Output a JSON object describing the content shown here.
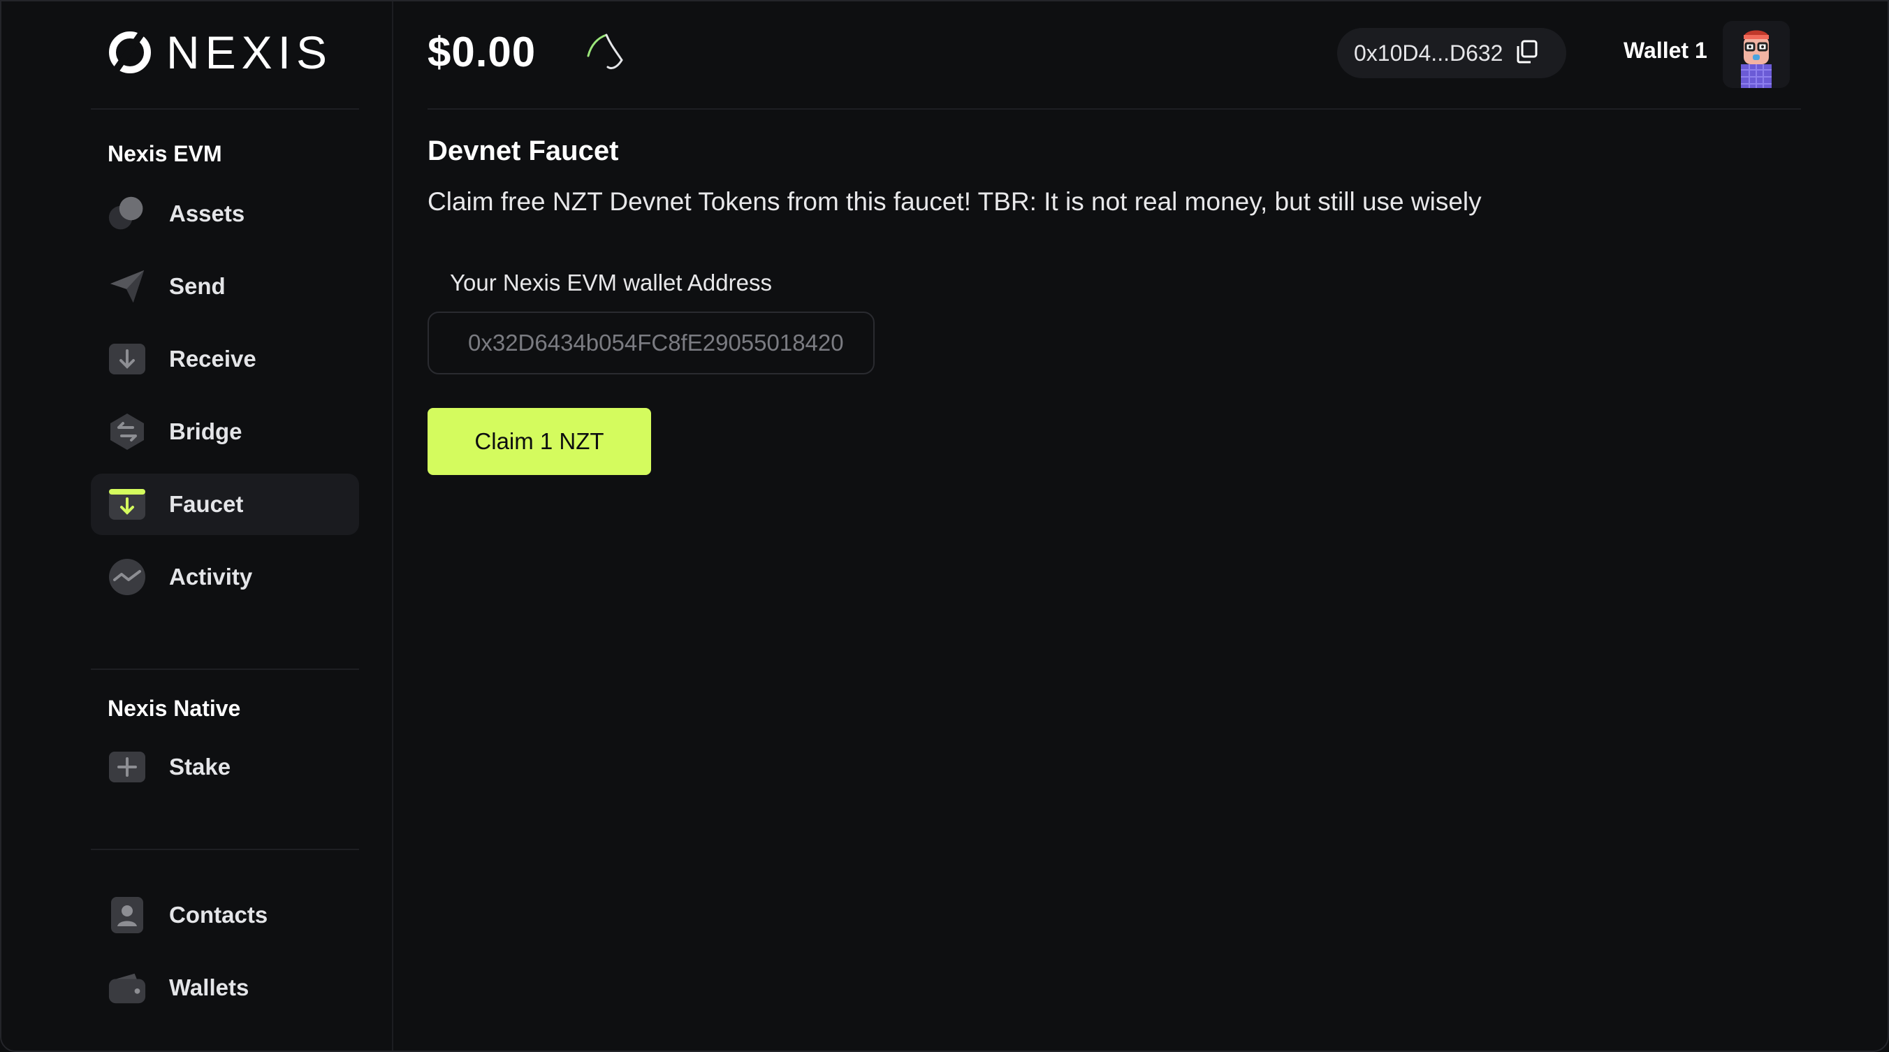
{
  "brand": {
    "logo_text": "NEXIS"
  },
  "header": {
    "balance": "$0.00",
    "address": "0x10D4...D632",
    "wallet_name": "Wallet 1"
  },
  "sidebar": {
    "sections": [
      {
        "title": "Nexis EVM",
        "items": [
          {
            "label": "Assets",
            "icon": "assets-icon"
          },
          {
            "label": "Send",
            "icon": "send-icon"
          },
          {
            "label": "Receive",
            "icon": "receive-icon"
          },
          {
            "label": "Bridge",
            "icon": "bridge-icon"
          },
          {
            "label": "Faucet",
            "icon": "faucet-icon",
            "active": true
          },
          {
            "label": "Activity",
            "icon": "activity-icon"
          }
        ]
      },
      {
        "title": "Nexis Native",
        "items": [
          {
            "label": "Stake",
            "icon": "stake-icon"
          }
        ]
      },
      {
        "title": "",
        "items": [
          {
            "label": "Contacts",
            "icon": "contacts-icon"
          },
          {
            "label": "Wallets",
            "icon": "wallets-icon"
          }
        ]
      }
    ]
  },
  "main": {
    "title": "Devnet Faucet",
    "description": "Claim free NZT Devnet Tokens from this faucet! TBR: It is not real money, but still use wisely",
    "address_field": {
      "label": "Your Nexis EVM wallet Address",
      "value": "0x32D6434b054FC8fE29055018420"
    },
    "claim_button": "Claim 1 NZT"
  },
  "colors": {
    "background": "#0e0f11",
    "accent": "#d4fb5e",
    "active_item_bg": "#1a1b1f"
  }
}
